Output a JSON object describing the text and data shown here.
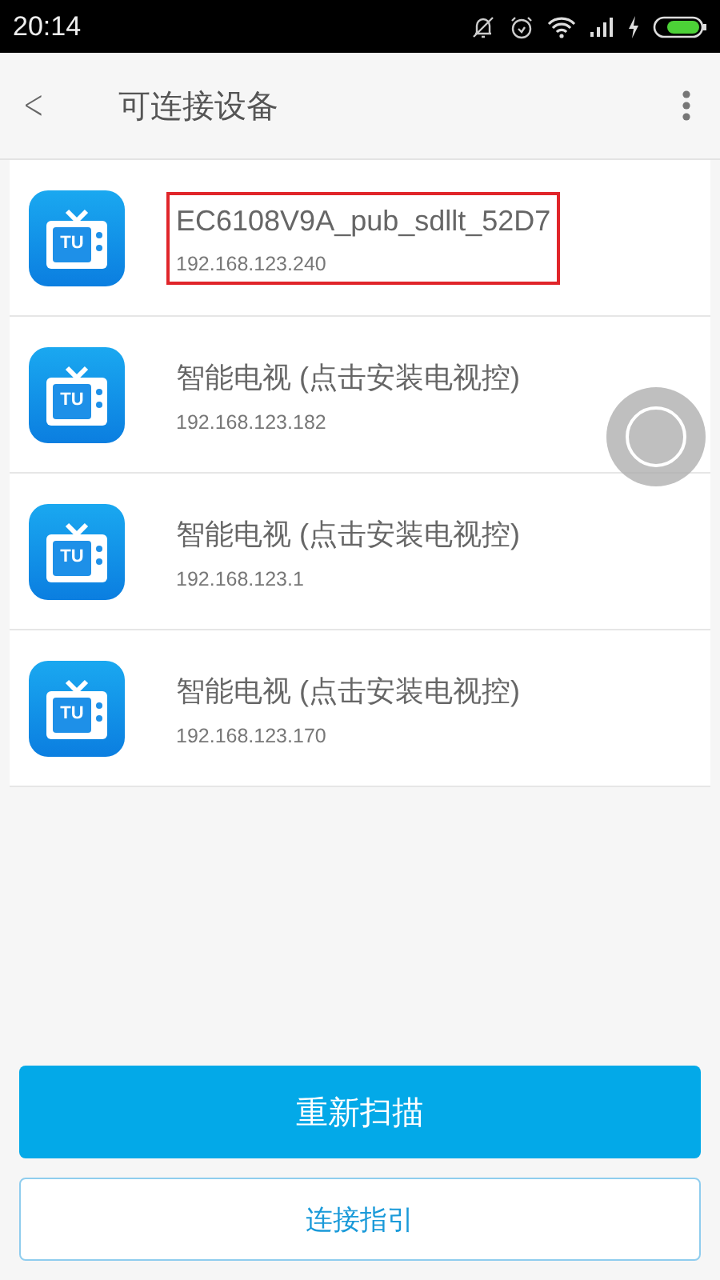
{
  "status_bar": {
    "time": "20:14"
  },
  "header": {
    "back": "<",
    "title": "可连接设备"
  },
  "devices": [
    {
      "icon_label": "TU",
      "name": "EC6108V9A_pub_sdllt_52D7",
      "address": "192.168.123.240",
      "highlighted": true
    },
    {
      "icon_label": "TU",
      "name": "智能电视 (点击安装电视控)",
      "address": "192.168.123.182",
      "highlighted": false
    },
    {
      "icon_label": "TU",
      "name": "智能电视 (点击安装电视控)",
      "address": "192.168.123.1",
      "highlighted": false
    },
    {
      "icon_label": "TU",
      "name": "智能电视 (点击安装电视控)",
      "address": "192.168.123.170",
      "highlighted": false
    }
  ],
  "buttons": [
    {
      "label": "重新扫描",
      "kind": "primary"
    },
    {
      "label": "连接指引",
      "kind": "outline"
    }
  ]
}
